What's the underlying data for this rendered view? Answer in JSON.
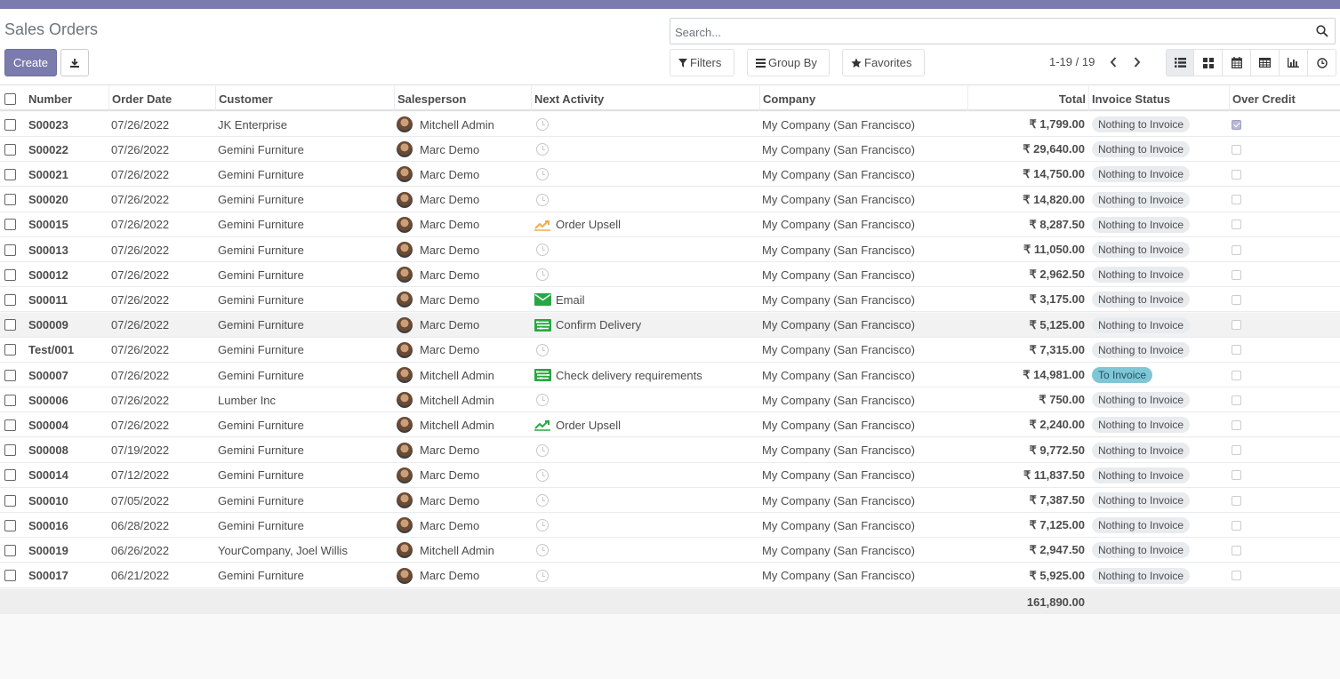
{
  "breadcrumb": {
    "title": "Sales Orders"
  },
  "actions": {
    "create_label": "Create"
  },
  "search": {
    "placeholder": "Search..."
  },
  "filters": {
    "filters_label": "Filters",
    "groupby_label": "Group By",
    "favorites_label": "Favorites"
  },
  "pager": {
    "value": "1-19 / 19"
  },
  "views": [
    "list",
    "kanban",
    "calendar",
    "pivot",
    "graph",
    "activity"
  ],
  "columns": {
    "number": "Number",
    "order_date": "Order Date",
    "customer": "Customer",
    "salesperson": "Salesperson",
    "next_activity": "Next Activity",
    "company": "Company",
    "total": "Total",
    "invoice_status": "Invoice Status",
    "over_credit": "Over Credit"
  },
  "rows": [
    {
      "number": "S00023",
      "date": "07/26/2022",
      "customer": "JK Enterprise",
      "salesperson": "Mitchell Admin",
      "activity": "",
      "activity_icon": "",
      "company": "My Company (San Francisco)",
      "total": "₹ 1,799.00",
      "invoice_status": "Nothing to Invoice",
      "over_credit": true
    },
    {
      "number": "S00022",
      "date": "07/26/2022",
      "customer": "Gemini Furniture",
      "salesperson": "Marc Demo",
      "activity": "",
      "activity_icon": "",
      "company": "My Company (San Francisco)",
      "total": "₹ 29,640.00",
      "invoice_status": "Nothing to Invoice",
      "over_credit": false
    },
    {
      "number": "S00021",
      "date": "07/26/2022",
      "customer": "Gemini Furniture",
      "salesperson": "Marc Demo",
      "activity": "",
      "activity_icon": "",
      "company": "My Company (San Francisco)",
      "total": "₹ 14,750.00",
      "invoice_status": "Nothing to Invoice",
      "over_credit": false
    },
    {
      "number": "S00020",
      "date": "07/26/2022",
      "customer": "Gemini Furniture",
      "salesperson": "Marc Demo",
      "activity": "",
      "activity_icon": "",
      "company": "My Company (San Francisco)",
      "total": "₹ 14,820.00",
      "invoice_status": "Nothing to Invoice",
      "over_credit": false
    },
    {
      "number": "S00015",
      "date": "07/26/2022",
      "customer": "Gemini Furniture",
      "salesperson": "Marc Demo",
      "activity": "Order Upsell",
      "activity_icon": "upsell-warning",
      "company": "My Company (San Francisco)",
      "total": "₹ 8,287.50",
      "invoice_status": "Nothing to Invoice",
      "over_credit": false
    },
    {
      "number": "S00013",
      "date": "07/26/2022",
      "customer": "Gemini Furniture",
      "salesperson": "Marc Demo",
      "activity": "",
      "activity_icon": "",
      "company": "My Company (San Francisco)",
      "total": "₹ 11,050.00",
      "invoice_status": "Nothing to Invoice",
      "over_credit": false
    },
    {
      "number": "S00012",
      "date": "07/26/2022",
      "customer": "Gemini Furniture",
      "salesperson": "Marc Demo",
      "activity": "",
      "activity_icon": "",
      "company": "My Company (San Francisco)",
      "total": "₹ 2,962.50",
      "invoice_status": "Nothing to Invoice",
      "over_credit": false
    },
    {
      "number": "S00011",
      "date": "07/26/2022",
      "customer": "Gemini Furniture",
      "salesperson": "Marc Demo",
      "activity": "Email",
      "activity_icon": "email",
      "company": "My Company (San Francisco)",
      "total": "₹ 3,175.00",
      "invoice_status": "Nothing to Invoice",
      "over_credit": false
    },
    {
      "number": "S00009",
      "date": "07/26/2022",
      "customer": "Gemini Furniture",
      "salesperson": "Marc Demo",
      "activity": "Confirm Delivery",
      "activity_icon": "tasks",
      "company": "My Company (San Francisco)",
      "total": "₹ 5,125.00",
      "invoice_status": "Nothing to Invoice",
      "over_credit": false
    },
    {
      "number": "Test/001",
      "date": "07/26/2022",
      "customer": "Gemini Furniture",
      "salesperson": "Marc Demo",
      "activity": "",
      "activity_icon": "",
      "company": "My Company (San Francisco)",
      "total": "₹ 7,315.00",
      "invoice_status": "Nothing to Invoice",
      "over_credit": false
    },
    {
      "number": "S00007",
      "date": "07/26/2022",
      "customer": "Gemini Furniture",
      "salesperson": "Mitchell Admin",
      "activity": "Check delivery requirements",
      "activity_icon": "tasks",
      "company": "My Company (San Francisco)",
      "total": "₹ 14,981.00",
      "invoice_status": "To Invoice",
      "over_credit": false
    },
    {
      "number": "S00006",
      "date": "07/26/2022",
      "customer": "Lumber Inc",
      "salesperson": "Mitchell Admin",
      "activity": "",
      "activity_icon": "",
      "company": "My Company (San Francisco)",
      "total": "₹ 750.00",
      "invoice_status": "Nothing to Invoice",
      "over_credit": false
    },
    {
      "number": "S00004",
      "date": "07/26/2022",
      "customer": "Gemini Furniture",
      "salesperson": "Mitchell Admin",
      "activity": "Order Upsell",
      "activity_icon": "upsell-success",
      "company": "My Company (San Francisco)",
      "total": "₹ 2,240.00",
      "invoice_status": "Nothing to Invoice",
      "over_credit": false
    },
    {
      "number": "S00008",
      "date": "07/19/2022",
      "customer": "Gemini Furniture",
      "salesperson": "Marc Demo",
      "activity": "",
      "activity_icon": "",
      "company": "My Company (San Francisco)",
      "total": "₹ 9,772.50",
      "invoice_status": "Nothing to Invoice",
      "over_credit": false
    },
    {
      "number": "S00014",
      "date": "07/12/2022",
      "customer": "Gemini Furniture",
      "salesperson": "Marc Demo",
      "activity": "",
      "activity_icon": "",
      "company": "My Company (San Francisco)",
      "total": "₹ 11,837.50",
      "invoice_status": "Nothing to Invoice",
      "over_credit": false
    },
    {
      "number": "S00010",
      "date": "07/05/2022",
      "customer": "Gemini Furniture",
      "salesperson": "Marc Demo",
      "activity": "",
      "activity_icon": "",
      "company": "My Company (San Francisco)",
      "total": "₹ 7,387.50",
      "invoice_status": "Nothing to Invoice",
      "over_credit": false
    },
    {
      "number": "S00016",
      "date": "06/28/2022",
      "customer": "Gemini Furniture",
      "salesperson": "Marc Demo",
      "activity": "",
      "activity_icon": "",
      "company": "My Company (San Francisco)",
      "total": "₹ 7,125.00",
      "invoice_status": "Nothing to Invoice",
      "over_credit": false
    },
    {
      "number": "S00019",
      "date": "06/26/2022",
      "customer": "YourCompany, Joel Willis",
      "salesperson": "Mitchell Admin",
      "activity": "",
      "activity_icon": "",
      "company": "My Company (San Francisco)",
      "total": "₹ 2,947.50",
      "invoice_status": "Nothing to Invoice",
      "over_credit": false
    },
    {
      "number": "S00017",
      "date": "06/21/2022",
      "customer": "Gemini Furniture",
      "salesperson": "Marc Demo",
      "activity": "",
      "activity_icon": "",
      "company": "My Company (San Francisco)",
      "total": "₹ 5,925.00",
      "invoice_status": "Nothing to Invoice",
      "over_credit": false
    }
  ],
  "footer": {
    "total_sum": "161,890.00"
  },
  "colors": {
    "brand": "#7c7bad",
    "upsell_warning": "#f0ad4e",
    "success": "#28a745",
    "to_invoice_badge": "#7fc6d6"
  }
}
